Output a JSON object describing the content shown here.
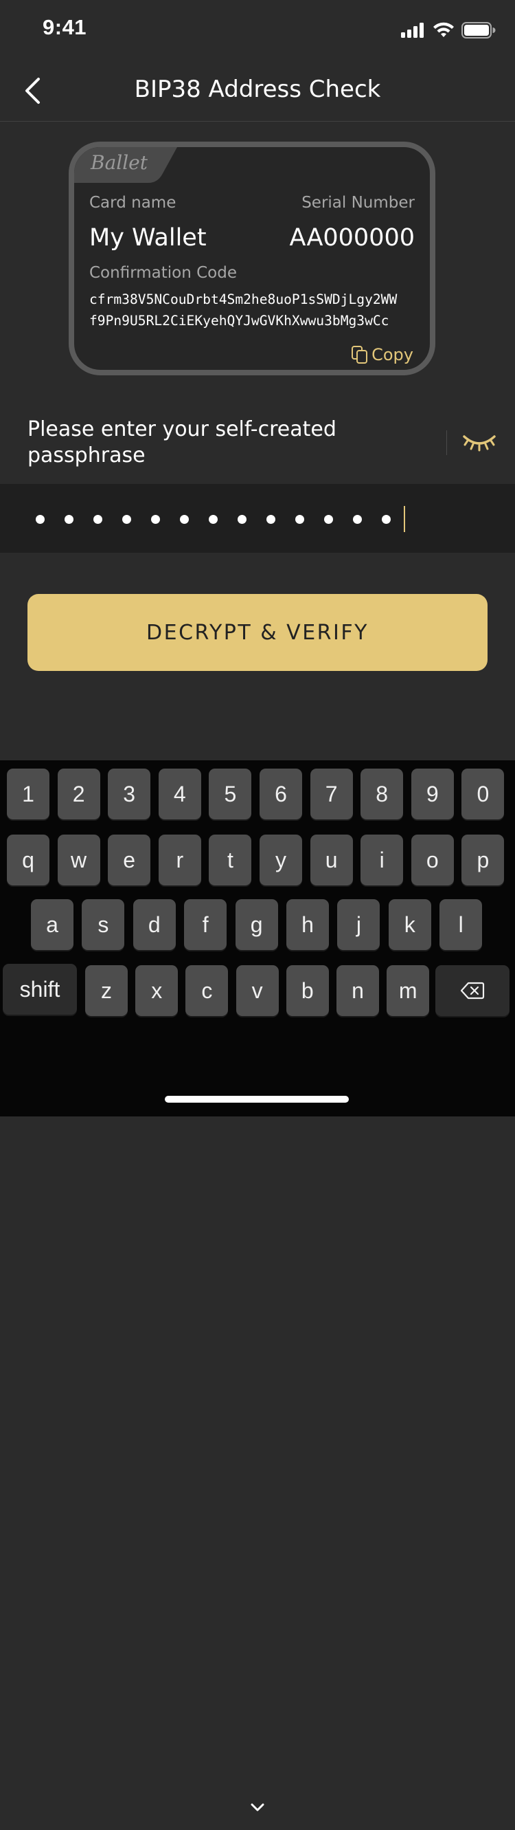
{
  "status": {
    "time": "9:41"
  },
  "nav": {
    "title": "BIP38 Address Check"
  },
  "card": {
    "brand": "Ballet",
    "name_label": "Card name",
    "name_value": "My Wallet",
    "serial_label": "Serial Number",
    "serial_value": "AA000000",
    "confirmation_label": "Confirmation Code",
    "confirmation_line1": "cfrm38V5NCouDrbt4Sm2he8uoP1sSWDjLgy2WW",
    "confirmation_line2": "f9Pn9U5RL2CiEKyehQYJwGVKhXwwu3bMg3wCc",
    "copy_label": "Copy"
  },
  "passphrase": {
    "prompt": "Please enter your self-created passphrase",
    "masked_length": 13
  },
  "actions": {
    "decrypt_label": "DECRYPT & VERIFY"
  },
  "keyboard": {
    "row_numbers": [
      "1",
      "2",
      "3",
      "4",
      "5",
      "6",
      "7",
      "8",
      "9",
      "0"
    ],
    "row_top": [
      "q",
      "w",
      "e",
      "r",
      "t",
      "y",
      "u",
      "i",
      "o",
      "p"
    ],
    "row_mid": [
      "a",
      "s",
      "d",
      "f",
      "g",
      "h",
      "j",
      "k",
      "l"
    ],
    "row_bottom": [
      "z",
      "x",
      "c",
      "v",
      "b",
      "n",
      "m"
    ],
    "shift_label": "shift"
  },
  "colors": {
    "accent": "#e4c879",
    "background": "#2b2b2b"
  },
  "icons": {
    "back": "chevron-left-icon",
    "copy": "copy-icon",
    "eye": "eye-closed-icon",
    "backspace": "backspace-icon",
    "dismiss": "chevron-down-icon"
  }
}
